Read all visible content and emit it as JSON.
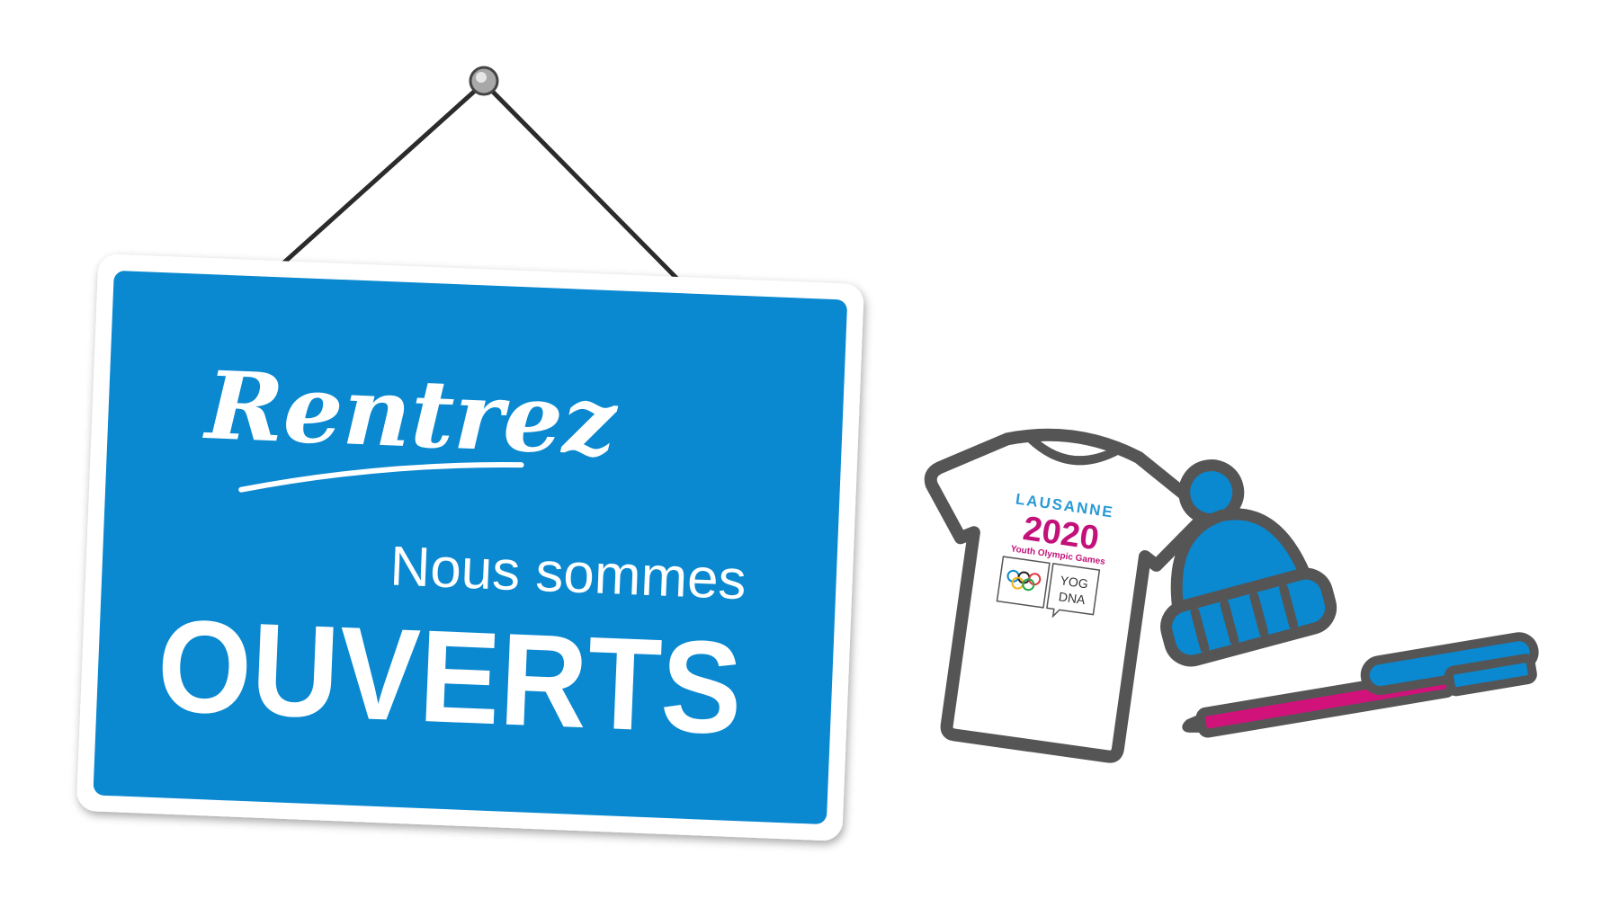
{
  "sign": {
    "script_line": "Rentrez",
    "line2": "Nous sommes",
    "line3": "OUVERTS",
    "color": "#0a88d0"
  },
  "merch": {
    "tshirt_logo": {
      "city": "LAUSANNE",
      "year": "2020",
      "subtitle": "Youth Olympic Games",
      "badge": "YOG DNA",
      "badge_line1": "YOG",
      "badge_line2": "DNA"
    },
    "colors": {
      "outline": "#555555",
      "blue": "#0a88d0",
      "magenta": "#d1127a"
    }
  }
}
